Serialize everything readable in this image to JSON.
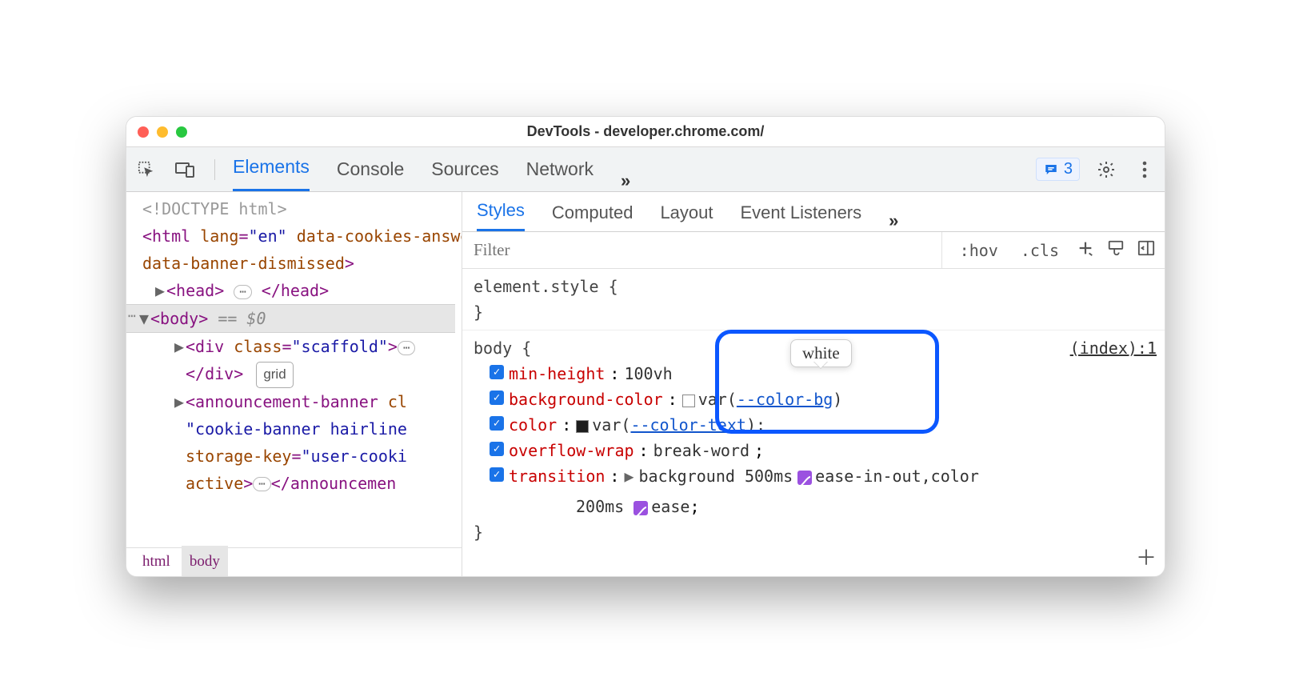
{
  "titlebar": {
    "title": "DevTools - developer.chrome.com/"
  },
  "toolbar": {
    "tabs": [
      "Elements",
      "Console",
      "Sources",
      "Network"
    ],
    "active_tab": 0,
    "overflow_glyph": "»",
    "messages_count": "3"
  },
  "dom": {
    "doctype": "<!DOCTYPE html>",
    "html_open": {
      "tag": "html",
      "attr1_name": "lang",
      "attr1_val": "\"en\"",
      "attr2": "data-cookies-answered",
      "attr3": "data-banner-dismissed"
    },
    "head_tag": "head",
    "body_tag": "body",
    "eq": " == $0",
    "div_class_name": "class",
    "div_class_val": "\"scaffold\"",
    "div_tag": "div",
    "grid_chip": "grid",
    "ab_tag": "announcement-banner",
    "ab_cl": "cl",
    "ab_cls_val": "\"cookie-banner hairline",
    "ab_sk_name": "storage-key",
    "ab_sk_val": "\"user-cooki",
    "ab_active": "active"
  },
  "breadcrumb": {
    "items": [
      "html",
      "body"
    ],
    "selected": 1
  },
  "subtabs": {
    "items": [
      "Styles",
      "Computed",
      "Layout",
      "Event Listeners"
    ],
    "active": 0,
    "overflow": "»"
  },
  "filterbar": {
    "placeholder": "Filter",
    "hov": ":hov",
    "cls": ".cls"
  },
  "rules": {
    "r0": {
      "selector": "element.style",
      "source": ""
    },
    "r1": {
      "selector": "body",
      "source": "(index):1",
      "p1_name": "min-height",
      "p1_val": "100vh",
      "p2_name": "background-color",
      "p2_var": "--color-bg",
      "p3_name": "color",
      "p3_var": "--color-text",
      "p4_name": "overflow-wrap",
      "p4_val": "break-word",
      "p5_name": "transition",
      "p5_seg1": "background 500ms",
      "p5_ease1": "ease-in-out",
      "p5_seg2_after": ",color",
      "p5_seg3": "200ms",
      "p5_ease2": "ease"
    }
  },
  "tooltip": {
    "text": "white"
  },
  "punct": {
    "semi": ";",
    "close_brace": "}",
    "open_brace": "{",
    "gt": ">",
    "lt": "<",
    "slash": "/",
    "eq": "=",
    "close_paren": ")",
    "var_open": "var("
  }
}
